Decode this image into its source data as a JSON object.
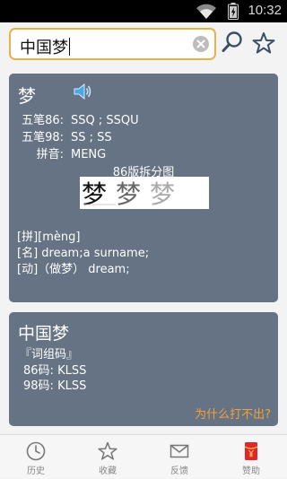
{
  "status_bar": {
    "time": "10:32"
  },
  "search": {
    "query": "中国梦"
  },
  "card_char": {
    "character": "梦",
    "rows": [
      {
        "label": "五笔86:",
        "value": "SSQ ; SSQU"
      },
      {
        "label": "五笔98:",
        "value": "SS ; SS"
      },
      {
        "label": "拼音:",
        "value": "MENG"
      }
    ],
    "split_title": "86版拆分图",
    "split_chars": [
      "梦",
      "梦",
      "梦"
    ],
    "definitions": [
      "[拼][mèng]",
      "[名] dream;a surname;",
      "[动]（做梦） dream;"
    ]
  },
  "card_phrase": {
    "phrase": "中国梦",
    "section": "『词组码』",
    "codes": [
      {
        "label": "86码:",
        "value": "KLSS"
      },
      {
        "label": "98码:",
        "value": "KLSS"
      }
    ],
    "why_link": "为什么打不出?"
  },
  "tabs": [
    {
      "label": "历史",
      "icon": "clock-icon"
    },
    {
      "label": "收藏",
      "icon": "star-icon"
    },
    {
      "label": "反馈",
      "icon": "mail-icon"
    },
    {
      "label": "赞助",
      "icon": "red-envelope-icon"
    }
  ],
  "colors": {
    "card": "#657384",
    "accent": "#e8b24a",
    "link": "#f0a23a",
    "sponsor": "#e1262b"
  }
}
